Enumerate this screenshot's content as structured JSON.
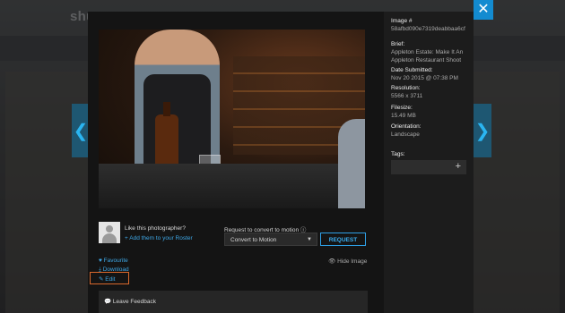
{
  "background": {
    "brand_text": "shu"
  },
  "close_label": "✕",
  "nav": {
    "prev": "❮",
    "next": "❯"
  },
  "photographer": {
    "prompt": "Like this photographer?",
    "add_link": "+ Add them to your Roster"
  },
  "motion": {
    "label": "Request to convert to motion",
    "info_icon": "ⓘ",
    "select_value": "Convert to Motion",
    "request_button": "REQUEST"
  },
  "actions": {
    "favourite": "Favourite",
    "download": "Download",
    "edit": "Edit",
    "hide_image": "Hide Image"
  },
  "feedback": {
    "label": "Leave Feedback"
  },
  "details": {
    "image_label": "Image #",
    "image_value": "58afbd090e7319deabbaa6cf",
    "brief_label": "Brief:",
    "brief_value": "Appleton Estate: Make It An Appleton Restaurant Shoot",
    "date_label": "Date Submitted:",
    "date_value": "Nov 20 2015 @ 07:38 PM",
    "resolution_label": "Resolution:",
    "resolution_value": "5566 x 3711",
    "filesize_label": "Filesize:",
    "filesize_value": "15.49 MB",
    "orientation_label": "Orientation:",
    "orientation_value": "Landscape",
    "tags_label": "Tags:",
    "tags_add": "+"
  },
  "colors": {
    "accent": "#2ea0e6",
    "close_bg": "#138bd0",
    "edit_highlight": "#d9682c"
  }
}
